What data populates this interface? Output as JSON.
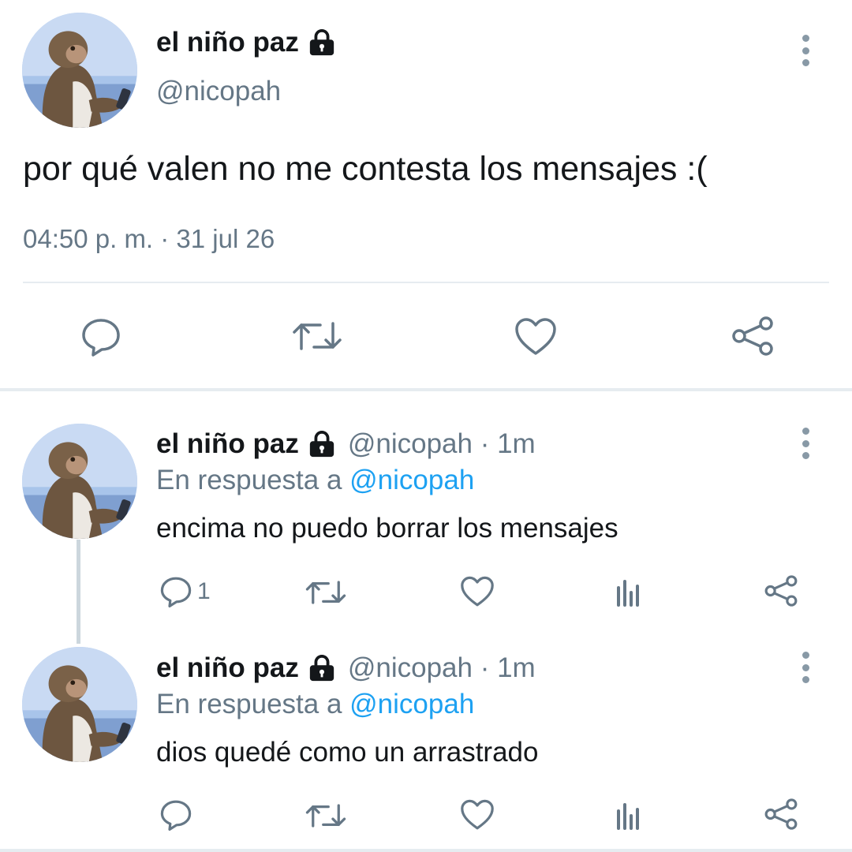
{
  "main_tweet": {
    "display_name": "el niño paz",
    "handle": "@nicopah",
    "text": "por qué valen no me contesta los mensajes :(",
    "timestamp": "04:50 p. m. · 31 jul 26",
    "icons": [
      "reply-icon",
      "retweet-icon",
      "like-icon",
      "share-icon"
    ]
  },
  "replies": [
    {
      "display_name": "el niño paz",
      "meta": "@nicopah · 1m",
      "replying_to_label": "En respuesta a ",
      "replying_to_handle": "@nicopah",
      "text": "encima no puedo borrar los mensajes",
      "reply_count": "1"
    },
    {
      "display_name": "el niño paz",
      "meta": "@nicopah · 1m",
      "replying_to_label": "En respuesta a ",
      "replying_to_handle": "@nicopah",
      "text": "dios quedé como un arrastrado",
      "reply_count": ""
    }
  ],
  "colors": {
    "text": "#14171a",
    "secondary": "#657786",
    "accent": "#1da1f2",
    "divider": "#e6ecf0"
  }
}
